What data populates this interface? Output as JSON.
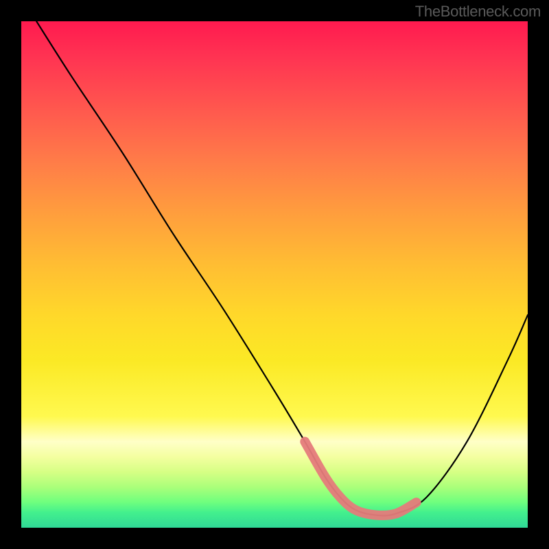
{
  "watermark": "TheBottleneck.com",
  "chart_data": {
    "type": "line",
    "title": "",
    "xlabel": "",
    "ylabel": "",
    "xlim": [
      0,
      100
    ],
    "ylim": [
      0,
      100
    ],
    "series": [
      {
        "name": "curve",
        "x": [
          3,
          10,
          20,
          30,
          40,
          50,
          56,
          60,
          63,
          66,
          70,
          74,
          80,
          88,
          96,
          100
        ],
        "y": [
          100,
          89,
          74,
          58,
          43,
          27,
          17,
          10,
          6,
          3.5,
          2.5,
          2.8,
          6,
          17,
          33,
          42
        ]
      },
      {
        "name": "flat-segment-highlight",
        "x": [
          56,
          60,
          63,
          66,
          70,
          74,
          78
        ],
        "y": [
          17,
          10,
          6,
          3.5,
          2.5,
          2.8,
          5
        ]
      }
    ],
    "colors": {
      "curve": "#000000",
      "highlight": "#e57b7b"
    }
  }
}
